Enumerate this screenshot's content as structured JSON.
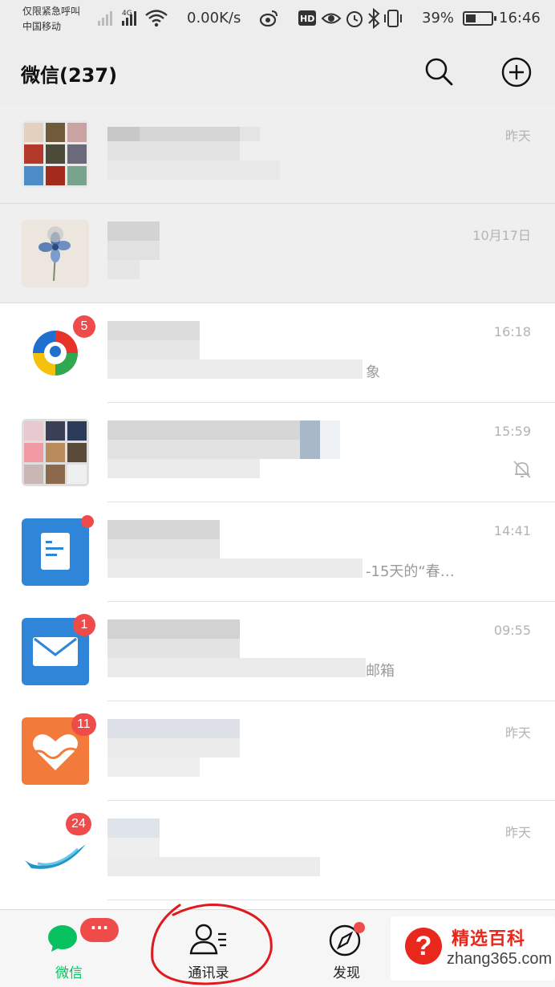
{
  "status_bar": {
    "carrier_line1": "仅限紧急呼叫",
    "carrier_line2": "中国移动",
    "network_type": "4G",
    "speed": "0.00K/s",
    "battery_percent": "39%",
    "battery_level": 0.39,
    "clock": "16:46",
    "hd_label": "HD",
    "icons": [
      "signal-icon",
      "wifi-icon",
      "weibo-icon",
      "eye-icon",
      "alarm-icon",
      "bluetooth-icon",
      "vibrate-icon",
      "battery-icon"
    ]
  },
  "header": {
    "title": "微信(237)",
    "icons": [
      "search-icon",
      "plus-circle-icon"
    ]
  },
  "chats": [
    {
      "time": "昨天",
      "preview_tail": "",
      "badge": "",
      "dot": false,
      "muted": false,
      "pinned": true
    },
    {
      "time": "10月17日",
      "preview_tail": "",
      "badge": "",
      "dot": false,
      "muted": false,
      "pinned": true
    },
    {
      "time": "16:18",
      "preview_tail": "象",
      "badge": "5",
      "dot": false,
      "muted": false,
      "pinned": false
    },
    {
      "time": "15:59",
      "preview_tail": "",
      "badge": "",
      "dot": false,
      "muted": true,
      "pinned": false
    },
    {
      "time": "14:41",
      "preview_tail": "-15天的“春…",
      "badge": "",
      "dot": true,
      "muted": false,
      "pinned": false
    },
    {
      "time": "09:55",
      "preview_tail": "邮箱",
      "badge": "1",
      "dot": false,
      "muted": false,
      "pinned": false
    },
    {
      "time": "昨天",
      "preview_tail": "",
      "badge": "11",
      "dot": false,
      "muted": false,
      "pinned": false
    },
    {
      "time": "昨天",
      "preview_tail": "",
      "badge": "24",
      "dot": false,
      "muted": false,
      "pinned": false
    }
  ],
  "tabbar": {
    "tabs": [
      {
        "label": "微信",
        "icon": "chat-bubbles-icon",
        "active": true
      },
      {
        "label": "通讯录",
        "icon": "contacts-icon",
        "active": false
      },
      {
        "label": "发现",
        "icon": "compass-icon",
        "active": false
      }
    ],
    "chat_badge": "···"
  },
  "watermark": {
    "title": "精选百科",
    "site": "zhang365.com"
  },
  "colors": {
    "accent_green": "#07c160",
    "badge_red": "#f04b4b",
    "header_bg": "#ededed",
    "annotation_red": "#e0191f"
  }
}
